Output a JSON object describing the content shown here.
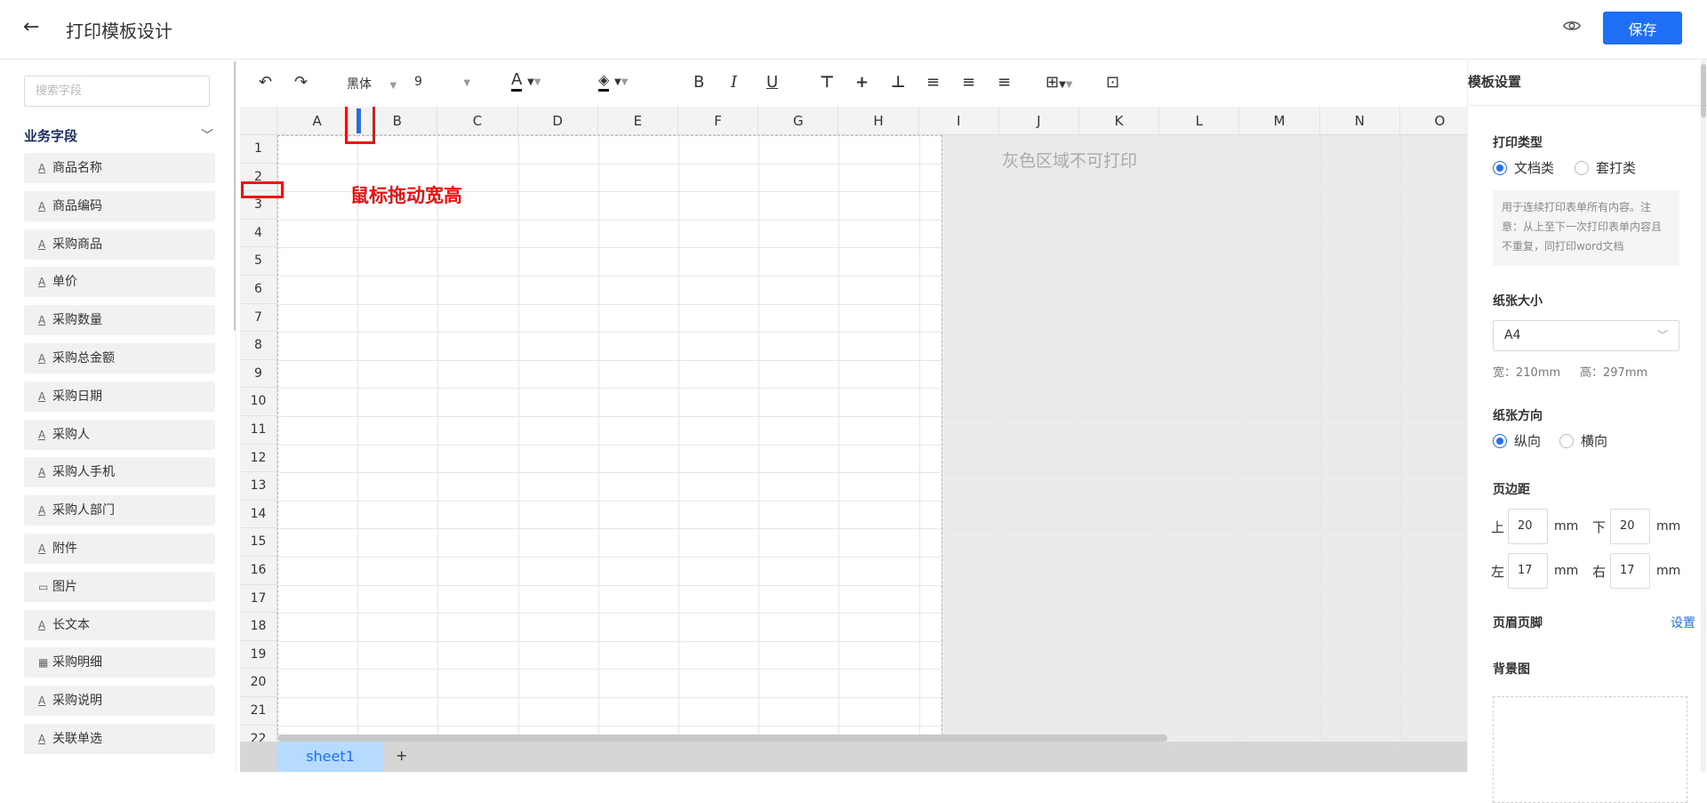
{
  "header": {
    "back_icon": "arrow-left-icon",
    "title": "打印模板设计",
    "preview_icon": "eye-icon",
    "save_label": "保存",
    "accent": "#1e6ff5"
  },
  "left": {
    "search_placeholder": "搜索字段",
    "group_title": "业务字段",
    "fields": [
      {
        "label": "商品名称",
        "icon": "text-icon"
      },
      {
        "label": "商品编码",
        "icon": "text-icon"
      },
      {
        "label": "采购商品",
        "icon": "text-icon"
      },
      {
        "label": "单价",
        "icon": "text-icon"
      },
      {
        "label": "采购数量",
        "icon": "text-icon"
      },
      {
        "label": "采购总金额",
        "icon": "text-icon"
      },
      {
        "label": "采购日期",
        "icon": "text-icon"
      },
      {
        "label": "采购人",
        "icon": "text-icon"
      },
      {
        "label": "采购人手机",
        "icon": "text-icon"
      },
      {
        "label": "采购人部门",
        "icon": "text-icon"
      },
      {
        "label": "附件",
        "icon": "text-icon"
      },
      {
        "label": "图片",
        "icon": "image-icon"
      },
      {
        "label": "长文本",
        "icon": "text-icon"
      },
      {
        "label": "采购明细",
        "icon": "table-icon"
      },
      {
        "label": "采购说明",
        "icon": "text-icon"
      },
      {
        "label": "关联单选",
        "icon": "text-icon"
      }
    ]
  },
  "toolbar": {
    "font": "黑体",
    "size": "9",
    "font_color_glyph": "A"
  },
  "grid": {
    "columns": [
      "A",
      "B",
      "C",
      "D",
      "E",
      "F",
      "G",
      "H",
      "I",
      "J",
      "K",
      "L",
      "M",
      "N",
      "O"
    ],
    "rows": [
      "1",
      "2",
      "3",
      "4",
      "5",
      "6",
      "7",
      "8",
      "9",
      "10",
      "11",
      "12",
      "13",
      "14",
      "15",
      "16",
      "17",
      "18",
      "19",
      "20",
      "21",
      "22"
    ],
    "gray_label": "灰色区域不可打印",
    "drag_label": "鼠标拖动宽高"
  },
  "sheets": {
    "tab": "sheet1",
    "add": "+"
  },
  "right": {
    "title": "模板设置",
    "print_type_label": "打印类型",
    "print_type_options": [
      "文档类",
      "套打类"
    ],
    "print_type_selected": "文档类",
    "note": "用于连续打印表单所有内容。注意：从上至下一次打印表单内容且不重复，同打印word文档",
    "paper_size_label": "纸张大小",
    "paper_size": "A4",
    "width_text": "宽：210mm",
    "height_text": "高：297mm",
    "orientation_label": "纸张方向",
    "orientation_options": [
      "纵向",
      "横向"
    ],
    "orientation_selected": "纵向",
    "margin_label": "页边距",
    "margins": {
      "top_label": "上",
      "top": "20",
      "bottom_label": "下",
      "bottom": "20",
      "left_label": "左",
      "left": "17",
      "right_label": "右",
      "right": "17",
      "unit": "mm"
    },
    "header_footer_label": "页眉页脚",
    "header_footer_action": "设置",
    "background_label": "背景图"
  }
}
